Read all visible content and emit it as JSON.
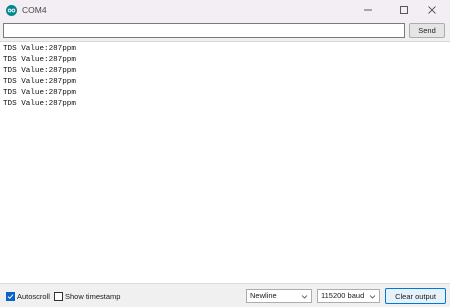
{
  "window": {
    "title": "COM4"
  },
  "input": {
    "value": "",
    "send_label": "Send"
  },
  "output": {
    "lines": [
      "TDS Value:287ppm",
      "TDS Value:287ppm",
      "TDS Value:287ppm",
      "TDS Value:287ppm",
      "TDS Value:287ppm",
      "TDS Value:287ppm"
    ]
  },
  "footer": {
    "autoscroll_label": "Autoscroll",
    "autoscroll_checked": true,
    "timestamp_label": "Show timestamp",
    "timestamp_checked": false,
    "line_ending": "Newline",
    "baud_rate": "115200 baud",
    "clear_label": "Clear output"
  },
  "colors": {
    "accent": "#0078d4",
    "app_icon": "#00878f"
  },
  "icons": {
    "app": "arduino-icon",
    "minimize": "minimize-icon",
    "maximize": "maximize-icon",
    "close": "close-icon",
    "dropdown": "chevron-down-icon",
    "check": "checkmark-icon"
  }
}
